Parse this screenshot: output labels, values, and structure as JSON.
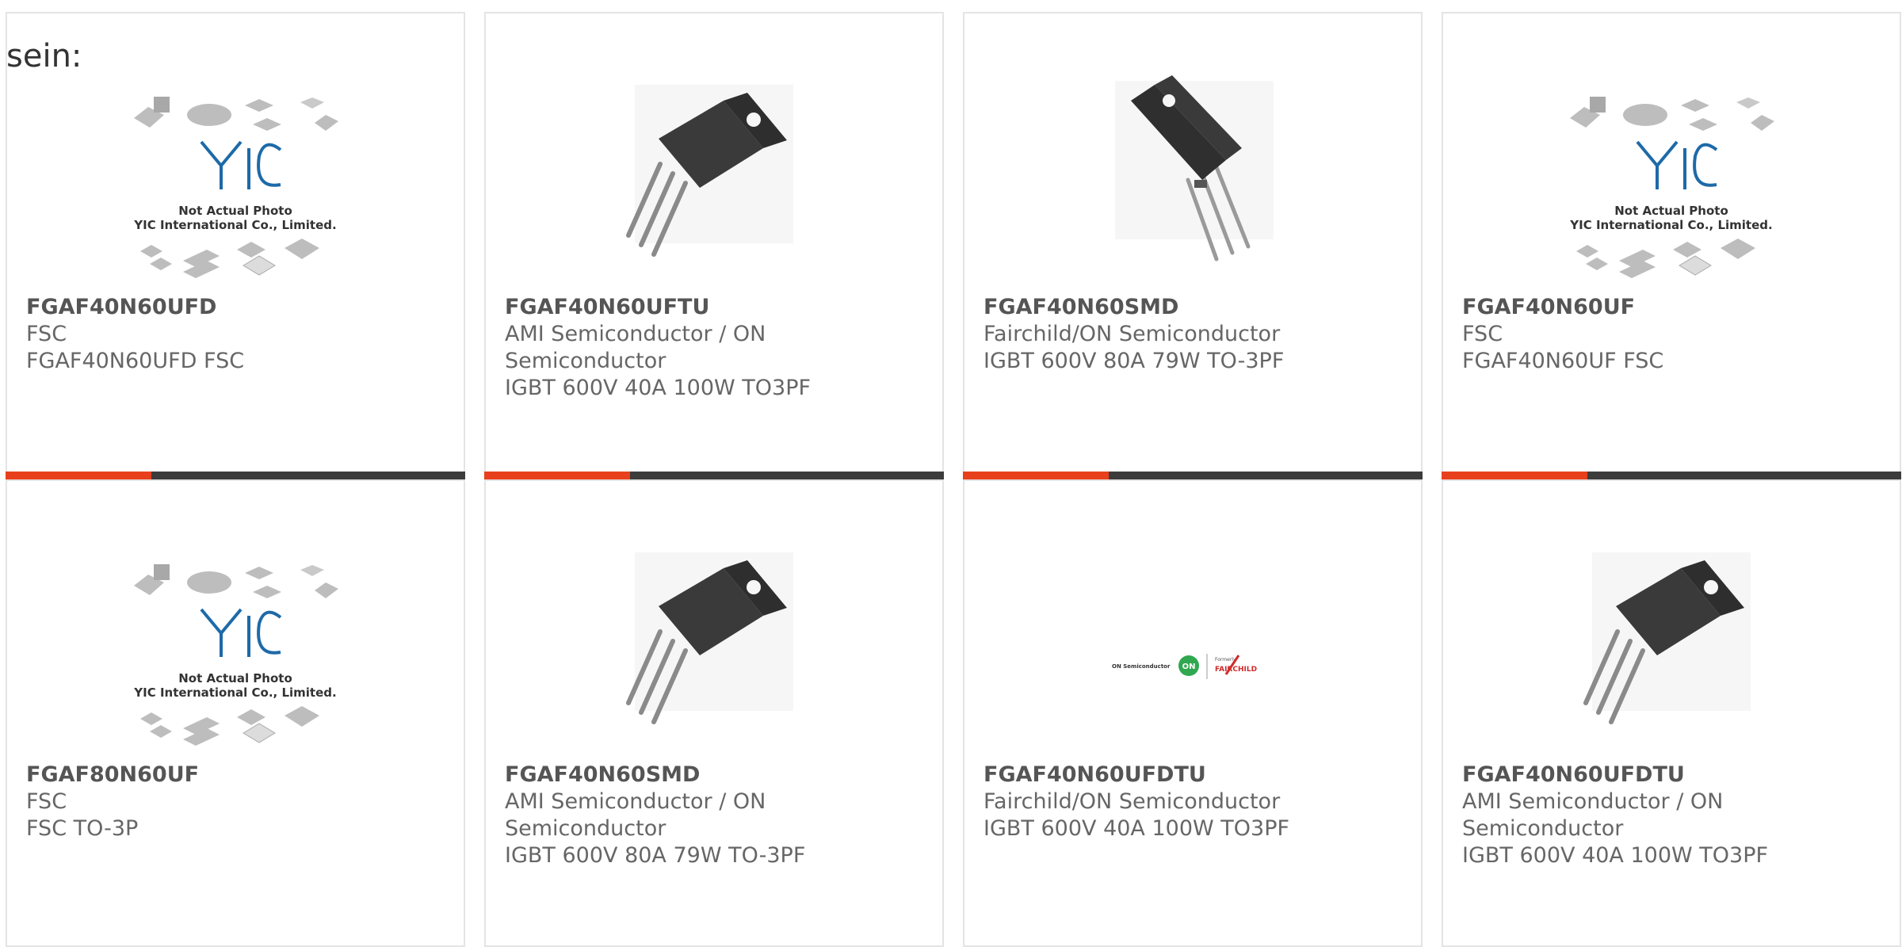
{
  "heading": "sein:",
  "colors": {
    "accent": "#e8401c",
    "bar_dark": "#3c3c3c",
    "card_border": "#e4e4e4"
  },
  "products": [
    {
      "part": "FGAF40N60UFD",
      "manufacturer": "FSC",
      "description": "FGAF40N60UFD FSC",
      "image": "yic-not-actual-photo",
      "logo_text": "YIC",
      "caption1": "Not Actual Photo",
      "caption2": "YIC International Co., Limited."
    },
    {
      "part": "FGAF40N60UFTU",
      "manufacturer": "AMI Semiconductor / ON Semiconductor",
      "description": "IGBT 600V 40A 100W TO3PF",
      "image": "to220-transistor-photo"
    },
    {
      "part": "FGAF40N60SMD",
      "manufacturer": "Fairchild/ON Semiconductor",
      "description": "IGBT 600V 80A 79W TO-3PF",
      "image": "to3pf-transistor-photo"
    },
    {
      "part": "FGAF40N60UF",
      "manufacturer": "FSC",
      "description": "FGAF40N60UF FSC",
      "image": "yic-not-actual-photo",
      "logo_text": "YIC",
      "caption1": "Not Actual Photo",
      "caption2": "YIC International Co., Limited."
    },
    {
      "part": "FGAF80N60UF",
      "manufacturer": "FSC",
      "description": "FSC TO-3P",
      "image": "yic-not-actual-photo",
      "logo_text": "YIC",
      "caption1": "Not Actual Photo",
      "caption2": "YIC International Co., Limited."
    },
    {
      "part": "FGAF40N60SMD",
      "manufacturer": "AMI Semiconductor / ON Semiconductor",
      "description": "IGBT 600V 80A 79W TO-3PF",
      "image": "to220-transistor-photo"
    },
    {
      "part": "FGAF40N60UFDTU",
      "manufacturer": "Fairchild/ON Semiconductor",
      "description": "IGBT 600V 40A 100W TO3PF",
      "image": "on-fairchild-logo",
      "logo_left": "ON Semiconductor",
      "logo_mid": "ON",
      "logo_small": "Formerly",
      "logo_right": "FAIRCHILD"
    },
    {
      "part": "FGAF40N60UFDTU",
      "manufacturer": "AMI Semiconductor / ON Semiconductor",
      "description": "IGBT 600V 40A 100W TO3PF",
      "image": "to220-transistor-photo"
    }
  ]
}
